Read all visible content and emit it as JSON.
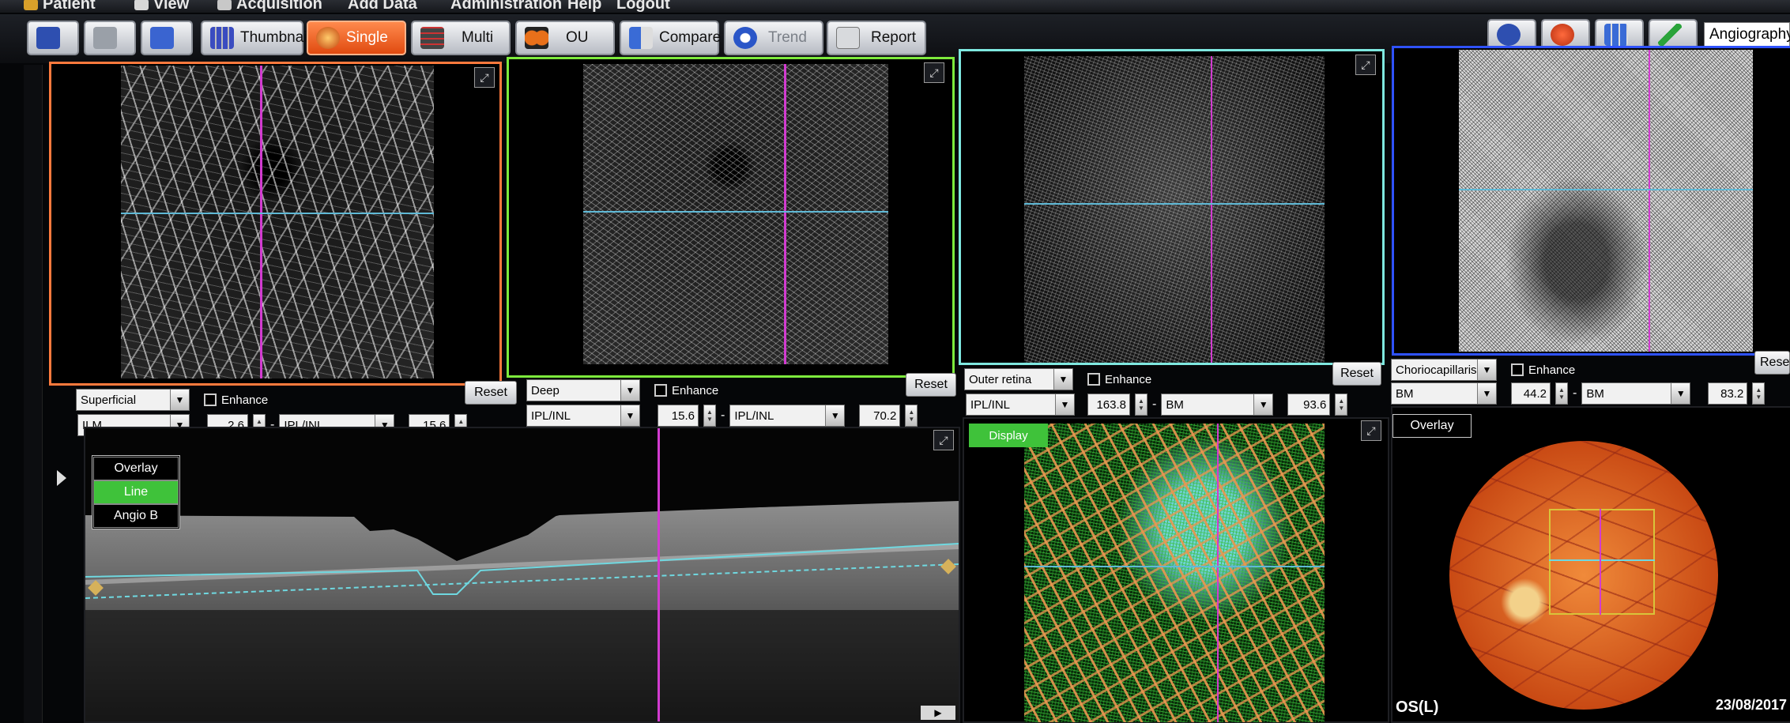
{
  "menu": {
    "items": [
      "Patient",
      "View",
      "Acquisition",
      "Add Data",
      "Administration",
      "Help",
      "Logout"
    ]
  },
  "toolbar": {
    "buttons": [
      "Thumbnail",
      "Single",
      "Multi",
      "OU",
      "Compare",
      "Trend",
      "Report"
    ],
    "mode_select": "Angiography"
  },
  "slabs": [
    {
      "layer": "Superficial",
      "enhance": "Enhance",
      "reset": "Reset",
      "top_boundary": "ILM",
      "top_offset": "2.6",
      "bottom_boundary": "IPL/INL",
      "bottom_offset": "15.6",
      "border_color": "#ff7a3d"
    },
    {
      "layer": "Deep",
      "enhance": "Enhance",
      "reset": "Reset",
      "top_boundary": "IPL/INL",
      "top_offset": "15.6",
      "bottom_boundary": "IPL/INL",
      "bottom_offset": "70.2",
      "border_color": "#7dea3c"
    },
    {
      "layer": "Outer retina",
      "enhance": "Enhance",
      "reset": "Reset",
      "top_boundary": "IPL/INL",
      "top_offset": "163.8",
      "bottom_boundary": "BM",
      "bottom_offset": "93.6",
      "border_color": "#7fe8e0"
    },
    {
      "layer": "Choriocapillaris",
      "enhance": "Enhance",
      "reset": "Reset",
      "top_boundary": "BM",
      "top_offset": "44.2",
      "bottom_boundary": "BM",
      "bottom_offset": "83.2",
      "border_color": "#2f52ff"
    }
  ],
  "bscan": {
    "buttons": [
      "Overlay",
      "Line",
      "Angio B"
    ],
    "active": "Line"
  },
  "composite": {
    "display_label": "Display"
  },
  "fundus": {
    "overlay_label": "Overlay",
    "eye": "OS(L)",
    "date": "23/08/2017"
  },
  "colors": {
    "accent": "#e8531a",
    "line_active": "#3fc23a",
    "magenta": "#d23bd0",
    "cyan": "#5fb9d6"
  }
}
